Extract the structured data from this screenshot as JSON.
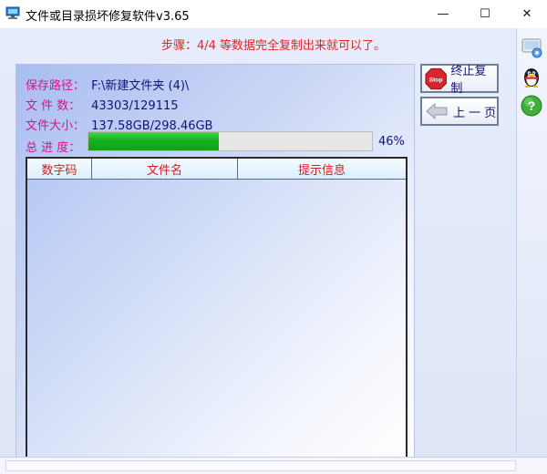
{
  "window": {
    "title": "文件或目录损坏修复软件v3.65",
    "min_glyph": "—",
    "max_glyph": "☐",
    "close_glyph": "✕"
  },
  "step": {
    "text": "步骤：4/4 等数据完全复制出来就可以了。"
  },
  "info": {
    "save_path_label": "保存路径：",
    "save_path_value": "F:\\新建文件夹 (4)\\",
    "file_count_label": "文 件 数：",
    "file_count_value": "43303/129115",
    "file_size_label": "文件大小：",
    "file_size_value": "137.58GB/298.46GB"
  },
  "progress": {
    "label": "总 进 度：",
    "percent_text": "46%",
    "value": 0.46
  },
  "table": {
    "columns": [
      "数字码",
      "文件名",
      "提示信息"
    ],
    "rows": []
  },
  "buttons": {
    "stop_label": "终止复制",
    "stop_icon_text": "Stop",
    "prev_label": "上 一 页"
  },
  "sidebar": {
    "icons": [
      "settings-icon",
      "qq-penguin-icon",
      "help-icon"
    ],
    "help_glyph": "?"
  },
  "colors": {
    "step_red": "#e8231f",
    "label_magenta": "#d8128a",
    "value_navy": "#12127a",
    "progress_green": "#15b020"
  }
}
